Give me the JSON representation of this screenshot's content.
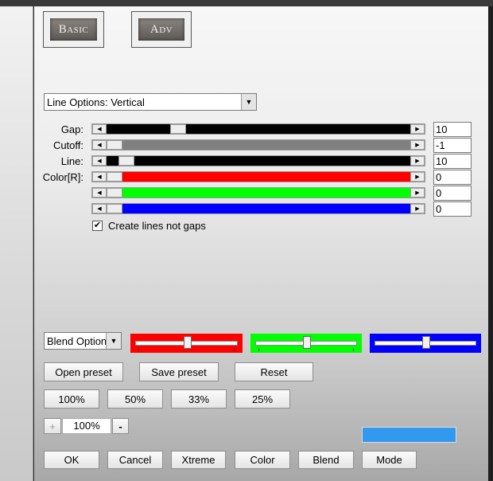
{
  "modes": {
    "basic": "Basic",
    "adv": "Adv"
  },
  "line_options": {
    "selected": "Line Options: Vertical"
  },
  "sliders": [
    {
      "label": "Gap:",
      "value": "10",
      "color": "#000000",
      "fill_level": 0.22
    },
    {
      "label": "Cutoff:",
      "value": "-1",
      "color": "#808080",
      "fill_level": 0.0
    },
    {
      "label": "Line:",
      "value": "10",
      "color": "#000000",
      "fill_level": 0.04
    },
    {
      "label": "Color[R]:",
      "value": "0",
      "color": "#ff0000",
      "fill_level": 0.0
    },
    {
      "label": "",
      "value": "0",
      "color": "#00ff00",
      "fill_level": 0.0
    },
    {
      "label": "",
      "value": "0",
      "color": "#0000ff",
      "fill_level": 0.0
    }
  ],
  "create_lines": {
    "label": "Create lines not gaps",
    "checked": true,
    "mark": "✔"
  },
  "blend": {
    "selected": "Blend Option",
    "red": {
      "color": "#ff0000",
      "level": 0.5
    },
    "green": {
      "color": "#00ff00",
      "level": 0.5
    },
    "blue": {
      "color": "#0000ff",
      "level": 0.5
    }
  },
  "preset_buttons": {
    "open": "Open preset",
    "save": "Save preset",
    "reset": "Reset"
  },
  "zoom_buttons": [
    "100%",
    "50%",
    "33%",
    "25%"
  ],
  "zoom": {
    "plus": "+",
    "value": "100%",
    "minus": "-"
  },
  "preview_color": "#3399ee",
  "bottom_buttons": [
    "OK",
    "Cancel",
    "Xtreme",
    "Color",
    "Blend",
    "Mode"
  ]
}
